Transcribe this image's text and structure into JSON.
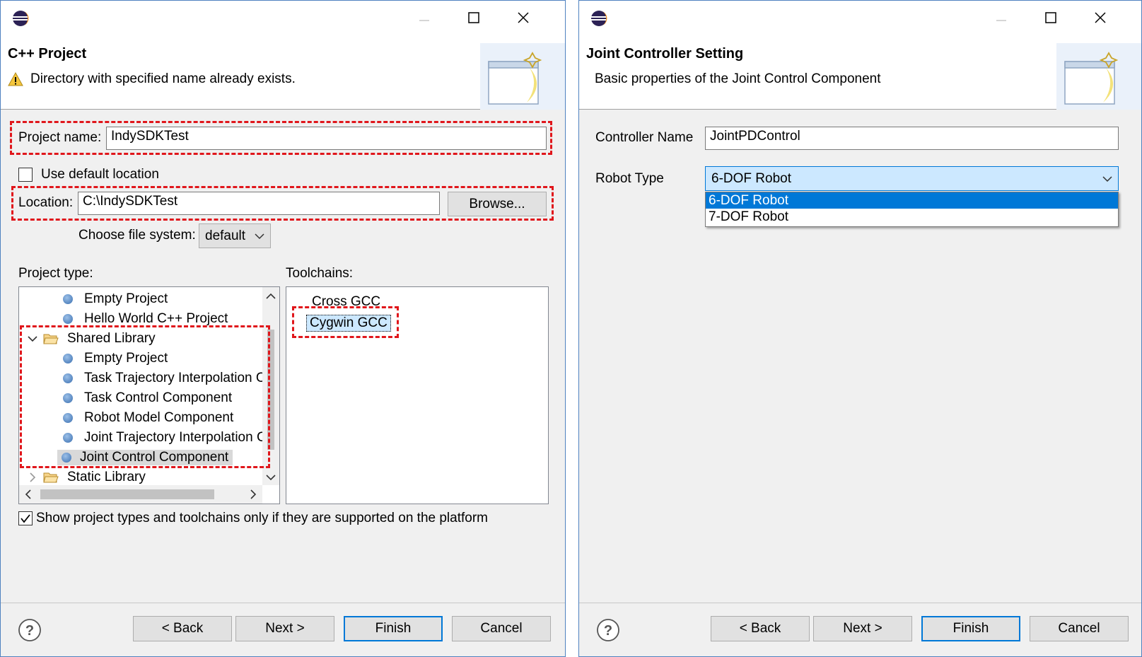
{
  "dialog1": {
    "banner_title": "C++ Project",
    "banner_message": "Directory with specified name already exists.",
    "project_name_label": "Project name:",
    "project_name_value": "IndySDKTest",
    "use_default_location_label": "Use default location",
    "use_default_location_checked": false,
    "location_label": "Location:",
    "location_value": "C:\\IndySDKTest",
    "browse_label": "Browse...",
    "file_system_label": "Choose file system:",
    "file_system_value": "default",
    "project_type_label": "Project type:",
    "toolchains_label": "Toolchains:",
    "project_types": [
      "Empty Project",
      "Hello World C++ Project",
      "Shared Library",
      "Empty Project",
      "Task Trajectory Interpolation C",
      "Task Control Component",
      "Robot Model Component",
      "Joint Trajectory Interpolation C",
      "Joint Control Component",
      "Static Library"
    ],
    "toolchains": [
      "Cross GCC",
      "Cygwin GCC"
    ],
    "show_supported_label": "Show project types and toolchains only if they are supported on the platform",
    "show_supported_checked": true
  },
  "dialog2": {
    "banner_title": "Joint Controller Setting",
    "banner_message": "Basic properties of the Joint Control Component",
    "controller_name_label": "Controller Name",
    "controller_name_value": "JointPDControl",
    "robot_type_label": "Robot Type",
    "robot_type_value": "6-DOF Robot",
    "robot_type_options": [
      "6-DOF Robot",
      "7-DOF Robot"
    ]
  },
  "buttons": {
    "back": "< Back",
    "next": "Next >",
    "finish": "Finish",
    "cancel": "Cancel"
  },
  "colors": {
    "highlight_dashed": "#e0161b",
    "selection_blue": "#0078d7",
    "window_border": "#4f82c0"
  }
}
